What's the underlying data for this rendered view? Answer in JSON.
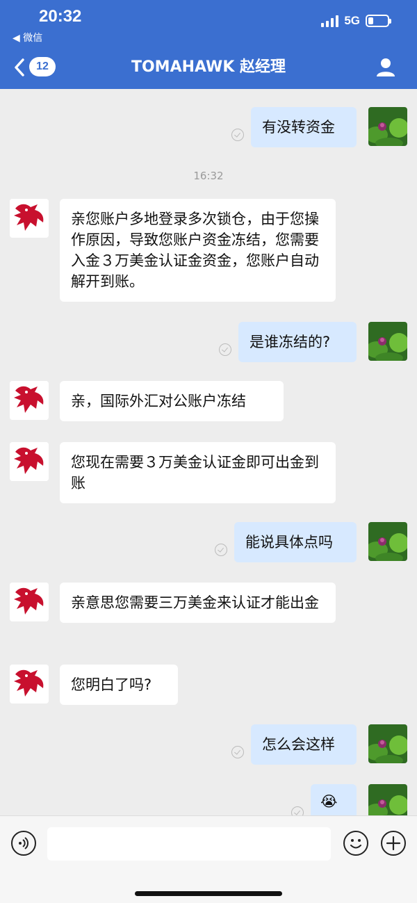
{
  "status": {
    "time": "20:32",
    "back_app": "◀ 微信",
    "network": "5G"
  },
  "header": {
    "unread_count": "12",
    "title": "TOMAHAWK 赵经理"
  },
  "messages": [
    {
      "from": "self",
      "text": "有没转资金"
    },
    {
      "timestamp": "16:32"
    },
    {
      "from": "contact",
      "text": "亲您账户多地登录多次锁仓，由于您操作原因，导致您账户资金冻结，您需要入金３万美金认证金资金，您账户自动解开到账。"
    },
    {
      "from": "self",
      "text": "是谁冻结的?"
    },
    {
      "from": "contact",
      "text": "亲，国际外汇对公账户冻结"
    },
    {
      "from": "contact",
      "text": "您现在需要３万美金认证金即可出金到账"
    },
    {
      "from": "self",
      "text": "能说具体点吗"
    },
    {
      "from": "contact",
      "text": "亲意思您需要三万美金来认证才能出金"
    },
    {
      "from": "contact",
      "text": "您明白了吗?"
    },
    {
      "from": "self",
      "text": "怎么会这样"
    },
    {
      "from": "self",
      "text": "😭"
    }
  ],
  "colors": {
    "header_bg": "#3b6fd0",
    "outgoing_bubble": "#d7e9ff",
    "incoming_bubble": "#ffffff"
  }
}
